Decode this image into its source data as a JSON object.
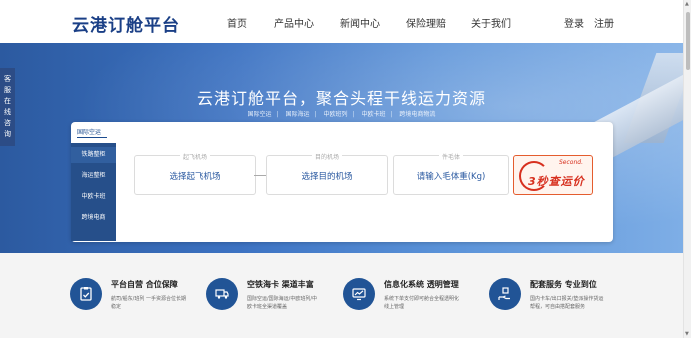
{
  "header": {
    "logo": "云港订舱平台",
    "nav": [
      "首页",
      "产品中心",
      "新闻中心",
      "保险理赔",
      "关于我们"
    ],
    "login": "登录",
    "register": "注册"
  },
  "side_tab": {
    "text": "客服在线咨询",
    "chars": [
      "客",
      "服",
      "在",
      "线",
      "咨",
      "询"
    ]
  },
  "hero": {
    "title": "云港订舱平台，聚合头程干线运力资源",
    "links": [
      "国际空运",
      "国际海运",
      "中欧班列",
      "中欧卡班",
      "跨境电商物流"
    ]
  },
  "search": {
    "active_tab": "国际空运",
    "side_items": [
      "铁路整柜",
      "海运整柜",
      "中欧卡班",
      "跨境电商"
    ],
    "origin": {
      "label": "起飞机场",
      "value": "选择起飞机场"
    },
    "destination": {
      "label": "目的机场",
      "value": "选择目的机场"
    },
    "weight": {
      "label": "件毛体",
      "value": "请输入毛体重(Kg)"
    },
    "promo": {
      "small": "Second.",
      "text": "3秒查运价"
    }
  },
  "features": [
    {
      "icon": "clipboard-check-icon",
      "title": "平台自营 合位保障",
      "desc": "航司/船东/班列 一手资源合位长期稳定"
    },
    {
      "icon": "truck-ship-icon",
      "title": "空铁海卡 渠道丰富",
      "desc": "国际空运/国际海运/中欧班列/中欧卡班全渠道覆盖"
    },
    {
      "icon": "monitor-chart-icon",
      "title": "信息化系统 透明管理",
      "desc": "系统下单支付即可舱合全程透明化线上管理"
    },
    {
      "icon": "hand-box-icon",
      "title": "配套服务 专业到位",
      "desc": "国内卡车/出口报关/垫派操作货运帮程，可自由搭配套服务"
    }
  ],
  "colors": {
    "brand": "#1a3f86",
    "hero_blue": "#3c72c2",
    "accent": "#d7301f"
  }
}
